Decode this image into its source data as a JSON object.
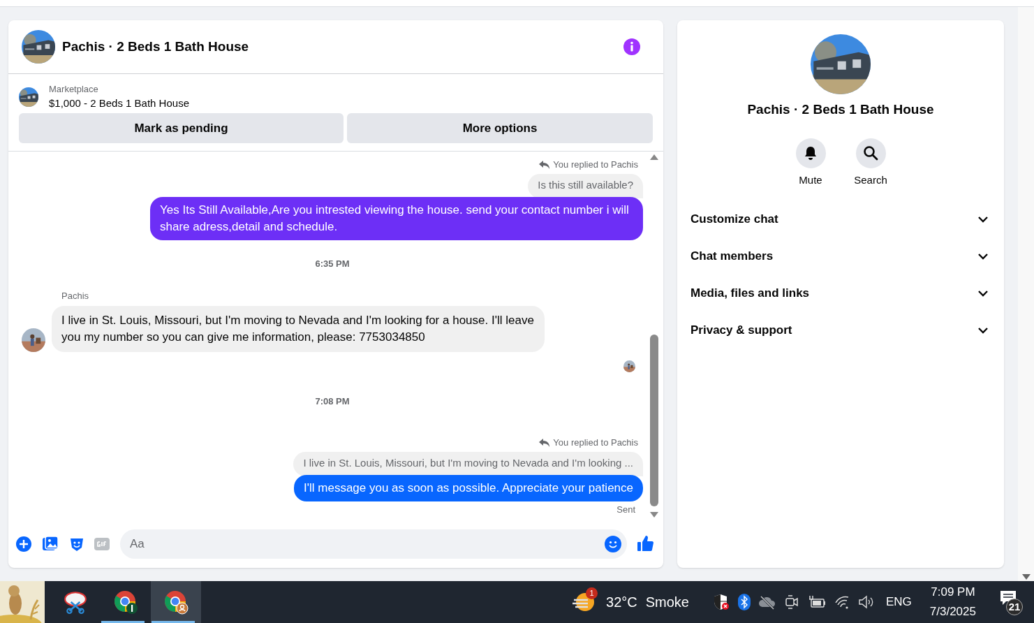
{
  "conversation": {
    "title": "Pachis · 2 Beds 1 Bath House",
    "listing": {
      "source": "Marketplace",
      "name": "$1,000 - 2 Beds 1 Bath House"
    },
    "actions": [
      "Mark as pending",
      "More options"
    ]
  },
  "messages": [
    {
      "kind": "reply_context",
      "text": "You replied to Pachis"
    },
    {
      "kind": "quoted",
      "text": "Is this still available?"
    },
    {
      "kind": "outgoing",
      "text": "Yes Its Still Available,Are you intrested viewing the house. send your contact number i will share adress,detail and schedule.",
      "color": "#6d2ff6"
    },
    {
      "kind": "timestamp",
      "text": "6:35 PM"
    },
    {
      "kind": "sender",
      "text": "Pachis"
    },
    {
      "kind": "incoming",
      "text": "I live in St. Louis, Missouri, but I'm moving to Nevada and I'm looking for a house. I'll leave you my number so you can give me information, please: 7753034850"
    },
    {
      "kind": "seen"
    },
    {
      "kind": "timestamp",
      "text": "7:08 PM"
    },
    {
      "kind": "reply_context",
      "text": "You replied to Pachis"
    },
    {
      "kind": "quoted",
      "text": "I live in St. Louis, Missouri, but I'm moving to Nevada and I'm looking ..."
    },
    {
      "kind": "outgoing",
      "text": "I'll message you as soon as possible. Appreciate your patience",
      "color": "#0866ff"
    },
    {
      "kind": "status",
      "text": "Sent"
    }
  ],
  "composer": {
    "placeholder": "Aa"
  },
  "details": {
    "title": "Pachis · 2 Beds 1 Bath House",
    "buttons": [
      {
        "kind": "mute",
        "label": "Mute"
      },
      {
        "kind": "search",
        "label": "Search"
      }
    ],
    "sections": [
      {
        "label": "Customize chat",
        "expanded": false
      },
      {
        "label": "Chat members",
        "expanded": false
      },
      {
        "label": "Media, files and links",
        "expanded": false
      },
      {
        "label": "Privacy & support",
        "expanded": false
      }
    ]
  },
  "taskbar": {
    "apps": [
      {
        "kind": "snip",
        "running": false,
        "selected": false
      },
      {
        "kind": "chrome",
        "running": true,
        "selected": false
      },
      {
        "kind": "chrome_profile",
        "running": true,
        "selected": true
      }
    ],
    "weather": {
      "badge": "1",
      "temperature": "32°C",
      "condition": "Smoke"
    },
    "language": "ENG",
    "time": "7:09 PM",
    "date": "7/3/2025",
    "notifications": "21"
  }
}
